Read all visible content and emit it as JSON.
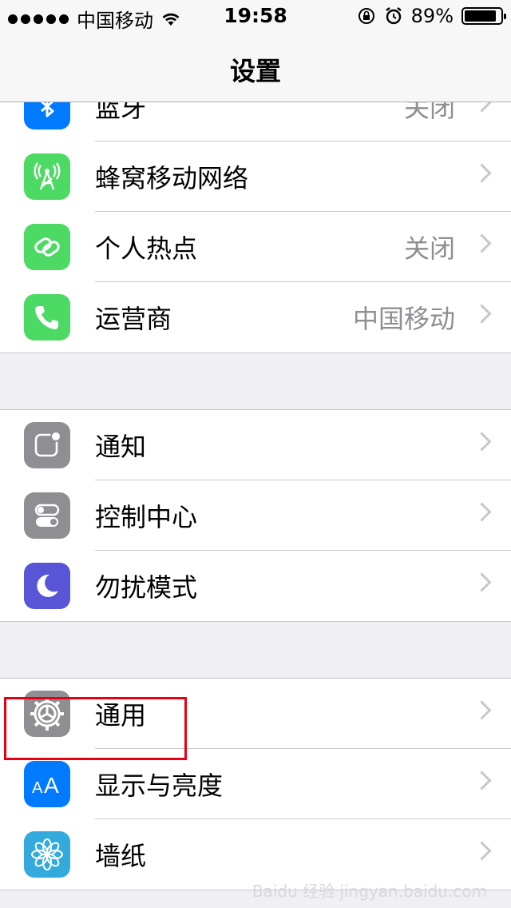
{
  "status_bar": {
    "carrier": "中国移动",
    "time": "19:58",
    "battery": "89%",
    "battery_level": 0.89,
    "icons": [
      "signal-dots-icon",
      "wifi-icon",
      "orientation-lock-icon",
      "alarm-icon",
      "battery-icon"
    ]
  },
  "nav": {
    "title": "设置"
  },
  "sections": [
    {
      "rows": [
        {
          "label": "蓝牙",
          "value": "关闭",
          "icon": "bluetooth-icon",
          "color": "#007aff"
        },
        {
          "label": "蜂窝移动网络",
          "value": "",
          "icon": "cellular-icon",
          "color": "#4cd964"
        },
        {
          "label": "个人热点",
          "value": "关闭",
          "icon": "hotspot-icon",
          "color": "#4cd964"
        },
        {
          "label": "运营商",
          "value": "中国移动",
          "icon": "phone-icon",
          "color": "#4cd964"
        }
      ]
    },
    {
      "rows": [
        {
          "label": "通知",
          "value": "",
          "icon": "notification-icon",
          "color": "#8e8e93"
        },
        {
          "label": "控制中心",
          "value": "",
          "icon": "control-center-icon",
          "color": "#8e8e93"
        },
        {
          "label": "勿扰模式",
          "value": "",
          "icon": "moon-icon",
          "color": "#5856d6"
        }
      ]
    },
    {
      "rows": [
        {
          "label": "通用",
          "value": "",
          "icon": "gear-icon",
          "color": "#8e8e93"
        },
        {
          "label": "显示与亮度",
          "value": "",
          "icon": "text-size-icon",
          "color": "#007aff"
        },
        {
          "label": "墙纸",
          "value": "",
          "icon": "wallpaper-icon",
          "color": "#34aadc"
        }
      ]
    }
  ],
  "highlight_color": "#e60012",
  "watermark": "Baidu 经验 jingyan.baidu.com"
}
